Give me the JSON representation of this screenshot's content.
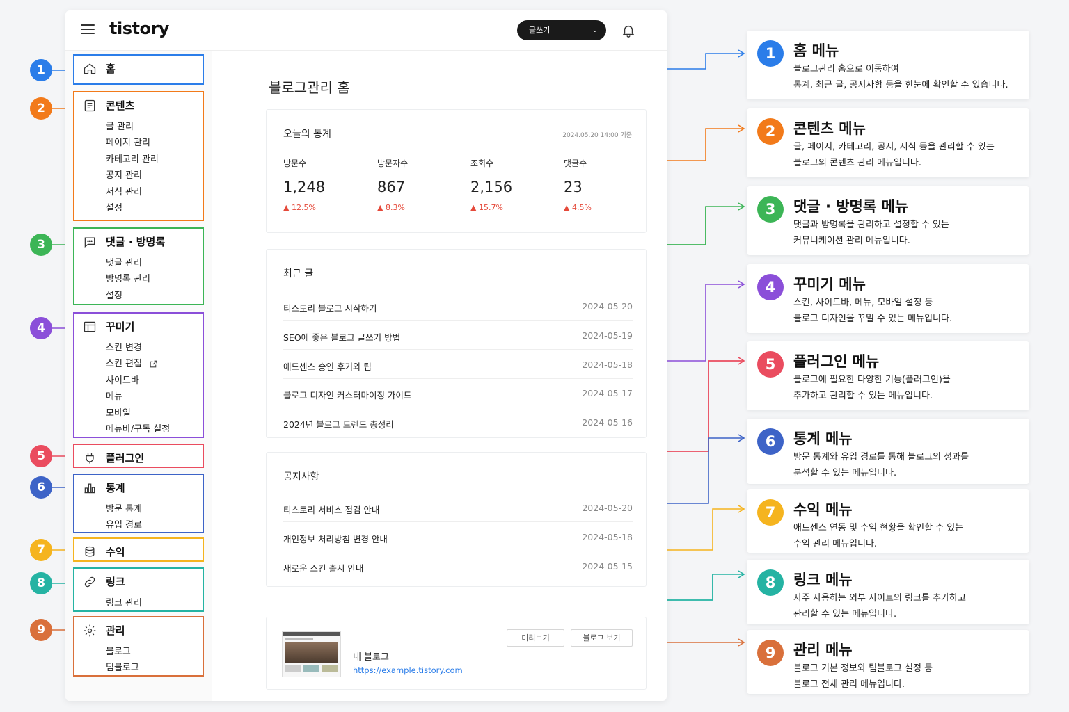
{
  "app": {
    "logo": "tistory",
    "write_button": "글쓰기",
    "main_title": "블로그관리 홈"
  },
  "sidebar": [
    {
      "num": "1",
      "color": "#2b7de9",
      "icon": "home-icon",
      "title": "홈",
      "items": []
    },
    {
      "num": "2",
      "color": "#f27a1a",
      "icon": "document-icon",
      "title": "콘텐츠",
      "items": [
        "글 관리",
        "페이지 관리",
        "카테고리 관리",
        "공지 관리",
        "서식 관리",
        "설정"
      ]
    },
    {
      "num": "3",
      "color": "#3cb556",
      "icon": "chat-icon",
      "title": "댓글 · 방명록",
      "items": [
        "댓글 관리",
        "방명록 관리",
        "설정"
      ]
    },
    {
      "num": "4",
      "color": "#8b4fd9",
      "icon": "layout-icon",
      "title": "꾸미기",
      "items": [
        "스킨 변경",
        "스킨 편집",
        "사이드바",
        "메뉴",
        "모바일",
        "메뉴바/구독 설정"
      ]
    },
    {
      "num": "5",
      "color": "#ea4c5f",
      "icon": "plug-icon",
      "title": "플러그인",
      "items": []
    },
    {
      "num": "6",
      "color": "#3d63c7",
      "icon": "chart-icon",
      "title": "통계",
      "items": [
        "방문 통계",
        "유입 경로"
      ]
    },
    {
      "num": "7",
      "color": "#f5b41f",
      "icon": "coins-icon",
      "title": "수익",
      "items": []
    },
    {
      "num": "8",
      "color": "#25b3a3",
      "icon": "link-icon",
      "title": "링크",
      "items": [
        "링크 관리"
      ]
    },
    {
      "num": "9",
      "color": "#d9703b",
      "icon": "gear-icon",
      "title": "관리",
      "items": [
        "블로그",
        "팀블로그"
      ]
    }
  ],
  "stats": {
    "title": "오늘의 통계",
    "date": "2024.05.20 14:00 기준",
    "items": [
      {
        "label": "방문수",
        "value": "1,248",
        "change": "▲ 12.5%"
      },
      {
        "label": "방문자수",
        "value": "867",
        "change": "▲ 8.3%"
      },
      {
        "label": "조회수",
        "value": "2,156",
        "change": "▲ 15.7%"
      },
      {
        "label": "댓글수",
        "value": "23",
        "change": "▲ 4.5%"
      }
    ]
  },
  "recent": {
    "title": "최근 글",
    "rows": [
      {
        "title": "티스토리 블로그 시작하기",
        "date": "2024-05-20"
      },
      {
        "title": "SEO에 좋은 블로그 글쓰기 방법",
        "date": "2024-05-19"
      },
      {
        "title": "애드센스 승인 후기와 팁",
        "date": "2024-05-18"
      },
      {
        "title": "블로그 디자인 커스터마이징 가이드",
        "date": "2024-05-17"
      },
      {
        "title": "2024년 블로그 트렌드 총정리",
        "date": "2024-05-16"
      }
    ]
  },
  "notices": {
    "title": "공지사항",
    "rows": [
      {
        "title": "티스토리 서비스 점검 안내",
        "date": "2024-05-20"
      },
      {
        "title": "개인정보 처리방침 변경 안내",
        "date": "2024-05-18"
      },
      {
        "title": "새로운 스킨 출시 안내",
        "date": "2024-05-15"
      }
    ]
  },
  "blog": {
    "name": "내 블로그",
    "url": "https://example.tistory.com",
    "preview_button": "미리보기",
    "view_button": "블로그 보기"
  },
  "info": [
    {
      "num": "1",
      "title": "홈 메뉴",
      "desc": [
        "블로그관리 홈으로 이동하여",
        "통계, 최근 글, 공지사항 등을 한눈에 확인할 수 있습니다."
      ]
    },
    {
      "num": "2",
      "title": "콘텐츠 메뉴",
      "desc": [
        "글, 페이지, 카테고리, 공지, 서식 등을 관리할 수 있는",
        "블로그의 콘텐츠 관리 메뉴입니다."
      ]
    },
    {
      "num": "3",
      "title": "댓글 · 방명록 메뉴",
      "desc": [
        "댓글과 방명록을 관리하고 설정할 수 있는",
        "커뮤니케이션 관리 메뉴입니다."
      ]
    },
    {
      "num": "4",
      "title": "꾸미기 메뉴",
      "desc": [
        "스킨, 사이드바, 메뉴, 모바일 설정 등",
        "블로그 디자인을 꾸밀 수 있는 메뉴입니다."
      ]
    },
    {
      "num": "5",
      "title": "플러그인 메뉴",
      "desc": [
        "블로그에 필요한 다양한 기능(플러그인)을",
        "추가하고 관리할 수 있는 메뉴입니다."
      ]
    },
    {
      "num": "6",
      "title": "통계 메뉴",
      "desc": [
        "방문 통계와 유입 경로를 통해 블로그의 성과를",
        "분석할 수 있는 메뉴입니다."
      ]
    },
    {
      "num": "7",
      "title": "수익 메뉴",
      "desc": [
        "애드센스 연동 및 수익 현황을 확인할 수 있는",
        "수익 관리 메뉴입니다."
      ]
    },
    {
      "num": "8",
      "title": "링크 메뉴",
      "desc": [
        "자주 사용하는 외부 사이트의 링크를 추가하고",
        "관리할 수 있는 메뉴입니다."
      ]
    },
    {
      "num": "9",
      "title": "관리 메뉴",
      "desc": [
        "블로그 기본 정보와 팀블로그 설정 등",
        "블로그 전체 관리 메뉴입니다."
      ]
    }
  ]
}
